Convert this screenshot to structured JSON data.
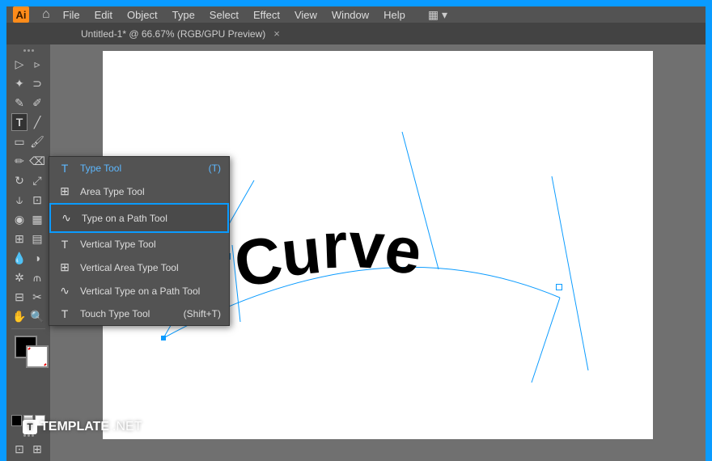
{
  "app": {
    "abbrev": "Ai"
  },
  "menu": [
    "File",
    "Edit",
    "Object",
    "Type",
    "Select",
    "Effect",
    "View",
    "Window",
    "Help"
  ],
  "tab": {
    "title": "Untitled-1* @ 66.67% (RGB/GPU Preview)",
    "close": "×"
  },
  "flyout": {
    "items": [
      {
        "label": "Type Tool",
        "shortcut": "(T)",
        "active": true,
        "icon": "T"
      },
      {
        "label": "Area Type Tool",
        "icon": "⊞"
      },
      {
        "label": "Type on a Path Tool",
        "highlighted": true,
        "icon": "∿"
      },
      {
        "label": "Vertical Type Tool",
        "icon": "T"
      },
      {
        "label": "Vertical Area Type Tool",
        "icon": "⊞"
      },
      {
        "label": "Vertical Type on a Path Tool",
        "icon": "∿"
      },
      {
        "label": "Touch Type Tool",
        "shortcut": "(Shift+T)",
        "icon": "T"
      }
    ]
  },
  "canvas": {
    "text": "Curve"
  },
  "watermark": {
    "brand": "TEMPLATE",
    "suffix": ".NET"
  }
}
